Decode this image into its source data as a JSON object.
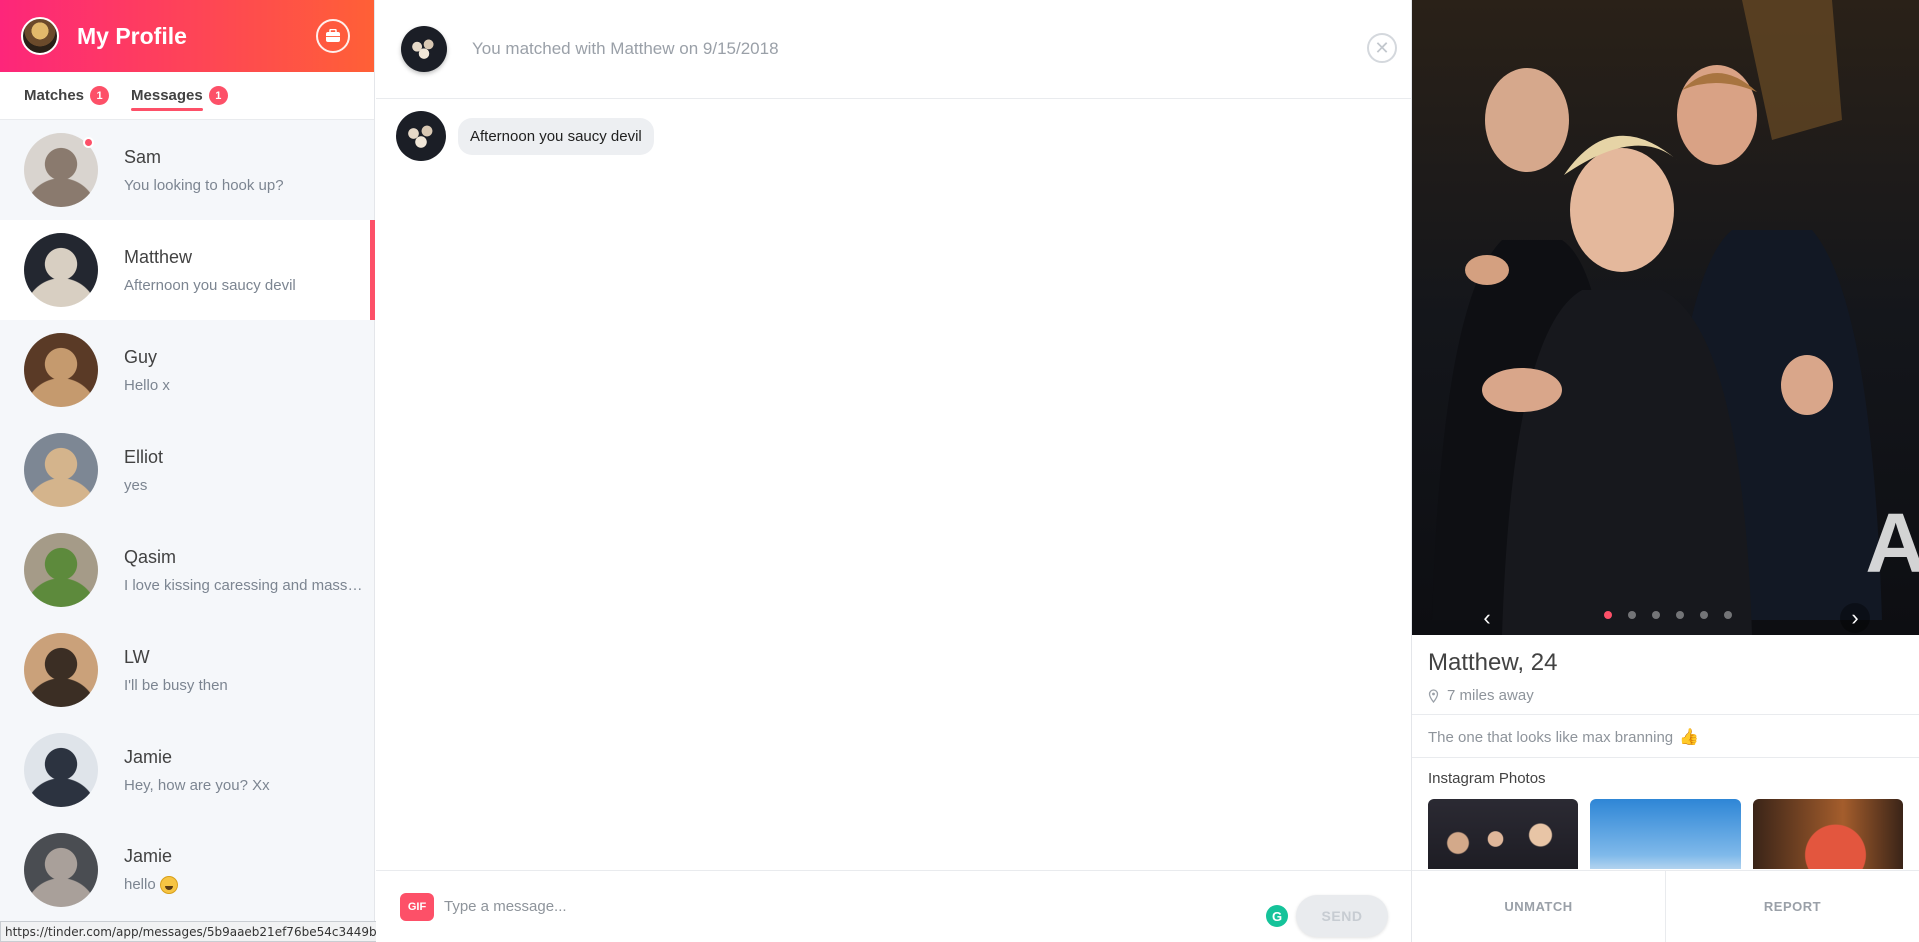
{
  "header": {
    "title": "My Profile",
    "avatar_icon": "profile-avatar",
    "briefcase_icon": "briefcase-icon"
  },
  "tabs": [
    {
      "label": "Matches",
      "badge": "1",
      "active": false
    },
    {
      "label": "Messages",
      "badge": "1",
      "active": true
    }
  ],
  "conversations": [
    {
      "name": "Sam",
      "preview": "You looking to hook up?",
      "unread": true,
      "selected": false,
      "colors": [
        "#d9d4cf",
        "#8a7a6e"
      ]
    },
    {
      "name": "Matthew",
      "preview": "Afternoon you saucy devil",
      "unread": false,
      "selected": true,
      "colors": [
        "#232730",
        "#d8cfc2"
      ]
    },
    {
      "name": "Guy",
      "preview": "Hello x",
      "unread": false,
      "selected": false,
      "colors": [
        "#5a3a26",
        "#c59a6e"
      ]
    },
    {
      "name": "Elliot",
      "preview": "yes",
      "unread": false,
      "selected": false,
      "colors": [
        "#7d8794",
        "#d4b48c"
      ]
    },
    {
      "name": "Qasim",
      "preview": "I love kissing caressing and massaging",
      "unread": false,
      "selected": false,
      "colors": [
        "#a59b88",
        "#5d8a3c"
      ]
    },
    {
      "name": "LW",
      "preview": "I'll be busy then",
      "unread": false,
      "selected": false,
      "colors": [
        "#caa17a",
        "#3b2e24"
      ]
    },
    {
      "name": "Jamie",
      "preview": "Hey, how are you? Xx",
      "unread": false,
      "selected": false,
      "colors": [
        "#dfe4ea",
        "#2c3340"
      ]
    },
    {
      "name": "Jamie",
      "preview": "hello",
      "unread": false,
      "selected": false,
      "emoji": true,
      "colors": [
        "#4a4d52",
        "#a9a09a"
      ]
    }
  ],
  "status_url": "https://tinder.com/app/messages/5b9aaeb21ef76be54c3449bf5b9d0b4eb4e969161e62cb0d",
  "chat": {
    "matched_text": "You matched with Matthew on 9/15/2018",
    "close_icon": "close-icon",
    "messages": [
      {
        "text": "Afternoon you saucy devil"
      }
    ],
    "composer": {
      "gif_label": "GIF",
      "placeholder": "Type a message...",
      "send_label": "SEND",
      "grammarly_label": "G"
    }
  },
  "profile": {
    "name_age": "Matthew, 24",
    "distance": "7 miles away",
    "bio": "The one that looks like max branning",
    "instagram_title": "Instagram Photos",
    "photo_count": 6,
    "photo_active_index": 0,
    "photo_overlay_letter": "A",
    "actions": {
      "unmatch": "UNMATCH",
      "report": "REPORT"
    }
  },
  "colors": {
    "accent": "#fd5068",
    "brand_gradient_start": "#fd267a",
    "brand_gradient_end": "#ff6036"
  }
}
